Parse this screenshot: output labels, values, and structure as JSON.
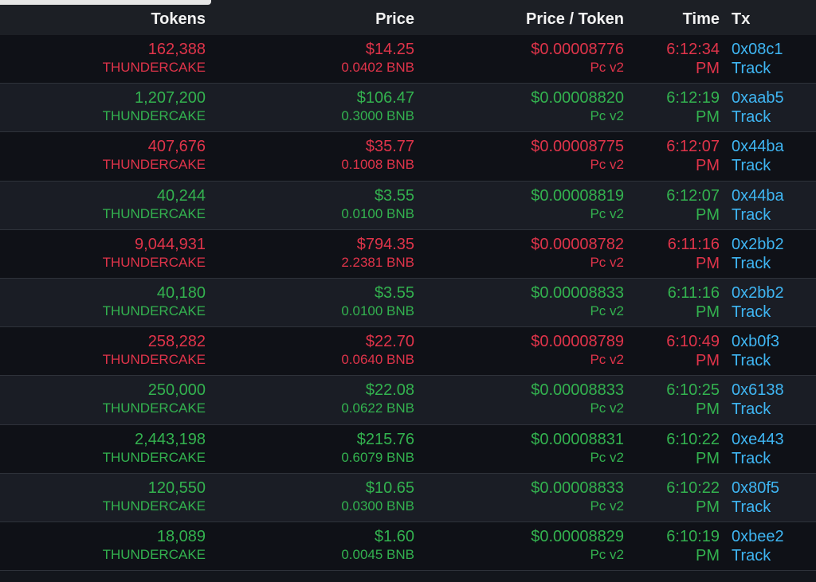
{
  "header": {
    "tokens": "Tokens",
    "price": "Price",
    "price_per_token": "Price / Token",
    "time": "Time",
    "tx": "Tx"
  },
  "colors": {
    "sell": "#e0344a",
    "buy": "#33b24f",
    "link": "#3fb6f3",
    "header_bg": "#1c1f25",
    "row_dark": "#0f1117",
    "row_light": "#1a1d25"
  },
  "rows": [
    {
      "side": "sell",
      "tokens": "162,388",
      "token_name": "THUNDERCAKE",
      "price_usd": "$14.25",
      "price_bnb": "0.0402 BNB",
      "price_per_token": "$0.00008776",
      "dex": "Pc v2",
      "time": "6:12:34",
      "ampm": "PM",
      "tx_hash": "0x08c1",
      "track": "Track"
    },
    {
      "side": "buy",
      "tokens": "1,207,200",
      "token_name": "THUNDERCAKE",
      "price_usd": "$106.47",
      "price_bnb": "0.3000 BNB",
      "price_per_token": "$0.00008820",
      "dex": "Pc v2",
      "time": "6:12:19",
      "ampm": "PM",
      "tx_hash": "0xaab5",
      "track": "Track"
    },
    {
      "side": "sell",
      "tokens": "407,676",
      "token_name": "THUNDERCAKE",
      "price_usd": "$35.77",
      "price_bnb": "0.1008 BNB",
      "price_per_token": "$0.00008775",
      "dex": "Pc v2",
      "time": "6:12:07",
      "ampm": "PM",
      "tx_hash": "0x44ba",
      "track": "Track"
    },
    {
      "side": "buy",
      "tokens": "40,244",
      "token_name": "THUNDERCAKE",
      "price_usd": "$3.55",
      "price_bnb": "0.0100 BNB",
      "price_per_token": "$0.00008819",
      "dex": "Pc v2",
      "time": "6:12:07",
      "ampm": "PM",
      "tx_hash": "0x44ba",
      "track": "Track"
    },
    {
      "side": "sell",
      "tokens": "9,044,931",
      "token_name": "THUNDERCAKE",
      "price_usd": "$794.35",
      "price_bnb": "2.2381 BNB",
      "price_per_token": "$0.00008782",
      "dex": "Pc v2",
      "time": "6:11:16",
      "ampm": "PM",
      "tx_hash": "0x2bb2",
      "track": "Track"
    },
    {
      "side": "buy",
      "tokens": "40,180",
      "token_name": "THUNDERCAKE",
      "price_usd": "$3.55",
      "price_bnb": "0.0100 BNB",
      "price_per_token": "$0.00008833",
      "dex": "Pc v2",
      "time": "6:11:16",
      "ampm": "PM",
      "tx_hash": "0x2bb2",
      "track": "Track"
    },
    {
      "side": "sell",
      "tokens": "258,282",
      "token_name": "THUNDERCAKE",
      "price_usd": "$22.70",
      "price_bnb": "0.0640 BNB",
      "price_per_token": "$0.00008789",
      "dex": "Pc v2",
      "time": "6:10:49",
      "ampm": "PM",
      "tx_hash": "0xb0f3",
      "track": "Track"
    },
    {
      "side": "buy",
      "tokens": "250,000",
      "token_name": "THUNDERCAKE",
      "price_usd": "$22.08",
      "price_bnb": "0.0622 BNB",
      "price_per_token": "$0.00008833",
      "dex": "Pc v2",
      "time": "6:10:25",
      "ampm": "PM",
      "tx_hash": "0x6138",
      "track": "Track"
    },
    {
      "side": "buy",
      "tokens": "2,443,198",
      "token_name": "THUNDERCAKE",
      "price_usd": "$215.76",
      "price_bnb": "0.6079 BNB",
      "price_per_token": "$0.00008831",
      "dex": "Pc v2",
      "time": "6:10:22",
      "ampm": "PM",
      "tx_hash": "0xe443",
      "track": "Track"
    },
    {
      "side": "buy",
      "tokens": "120,550",
      "token_name": "THUNDERCAKE",
      "price_usd": "$10.65",
      "price_bnb": "0.0300 BNB",
      "price_per_token": "$0.00008833",
      "dex": "Pc v2",
      "time": "6:10:22",
      "ampm": "PM",
      "tx_hash": "0x80f5",
      "track": "Track"
    },
    {
      "side": "buy",
      "tokens": "18,089",
      "token_name": "THUNDERCAKE",
      "price_usd": "$1.60",
      "price_bnb": "0.0045 BNB",
      "price_per_token": "$0.00008829",
      "dex": "Pc v2",
      "time": "6:10:19",
      "ampm": "PM",
      "tx_hash": "0xbee2",
      "track": "Track"
    }
  ]
}
